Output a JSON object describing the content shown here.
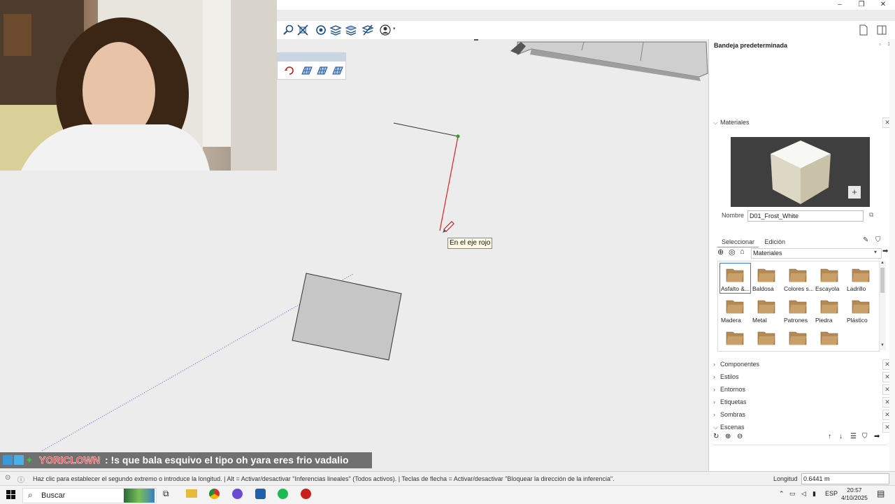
{
  "window": {
    "controls": [
      "–",
      "❐",
      "✕"
    ]
  },
  "panel": {
    "title": "Bandeja predeterminada",
    "materials_section": "Materiales",
    "name_label": "Nombre",
    "name_value": "D01_Frost_White",
    "tabs": [
      "Seleccionar",
      "Edición"
    ],
    "collection": "Materiales",
    "materials": [
      {
        "label": "Asfalto &..."
      },
      {
        "label": "Baldosa"
      },
      {
        "label": "Colores s..."
      },
      {
        "label": "Escayola"
      },
      {
        "label": "Ladrillo"
      },
      {
        "label": "Madera"
      },
      {
        "label": "Metal"
      },
      {
        "label": "Patrones"
      },
      {
        "label": "Piedra"
      },
      {
        "label": "Plástico"
      },
      {
        "label": ""
      },
      {
        "label": ""
      },
      {
        "label": ""
      },
      {
        "label": ""
      }
    ],
    "sections": [
      {
        "label": "Componentes"
      },
      {
        "label": "Estilos"
      },
      {
        "label": "Entornos"
      },
      {
        "label": "Etiquetas"
      },
      {
        "label": "Sombras"
      },
      {
        "label": "Escenas"
      }
    ]
  },
  "viewport": {
    "tooltip": "En el eje rojo"
  },
  "status": {
    "hint": "Haz clic para establecer el segundo extremo o introduce la longitud. | Alt = Activar/desactivar \"Inferencias lineales\" (Todos activos). | Teclas de flecha = Activar/desactivar \"Bloquear la dirección de la inferencia\".",
    "length_label": "Longitud",
    "length_value": "0.6441 m"
  },
  "chat": {
    "user": "YORICLOWN",
    "message": ": !s que bala esquivo el tipo oh yara eres frio vadalio"
  },
  "taskbar": {
    "search": "Buscar",
    "lang": "ESP",
    "time": "20:57",
    "date": "4/10/2025"
  },
  "colors": {
    "red_axis": "#e02020",
    "material_thumb": "#b58a52",
    "accent": "#3a7bd5"
  }
}
